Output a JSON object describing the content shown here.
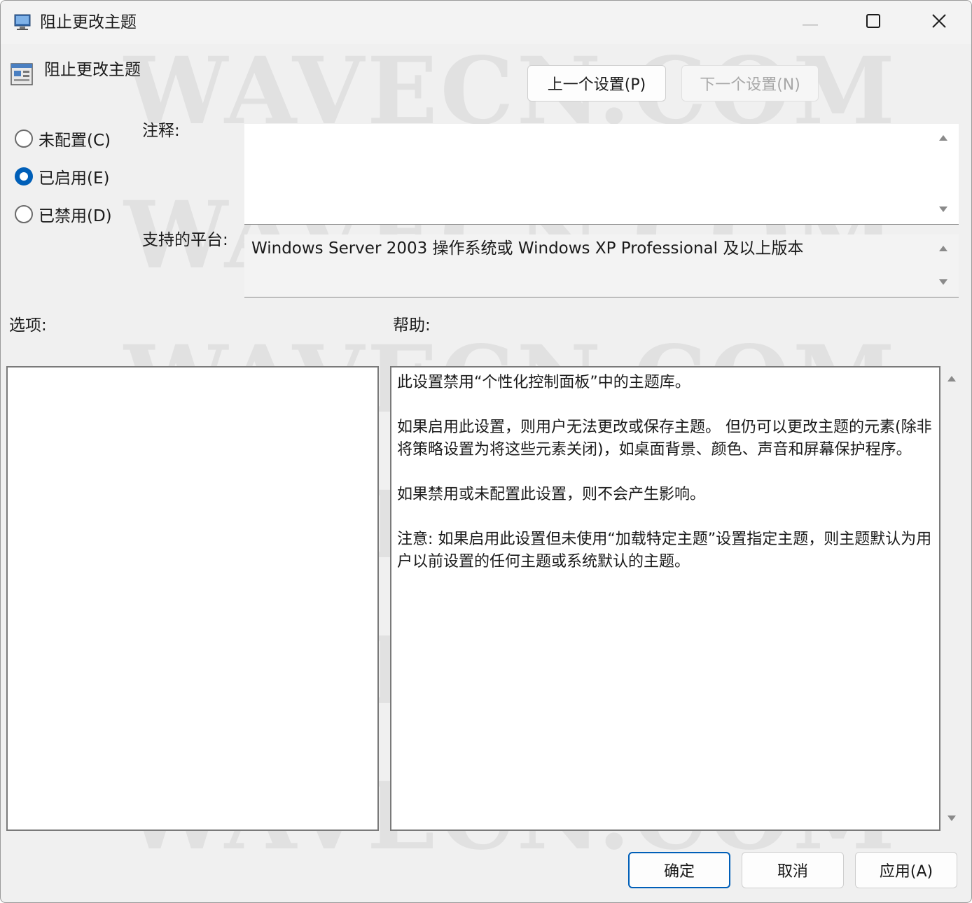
{
  "window": {
    "title": "阻止更改主题"
  },
  "header": {
    "policy_name": "阻止更改主题",
    "prev_button": "上一个设置(P)",
    "next_button": "下一个设置(N)"
  },
  "state": {
    "options": [
      {
        "label": "未配置(C)",
        "selected": false
      },
      {
        "label": "已启用(E)",
        "selected": true
      },
      {
        "label": "已禁用(D)",
        "selected": false
      }
    ]
  },
  "fields": {
    "comment_label": "注释:",
    "comment_value": "",
    "platform_label": "支持的平台:",
    "platform_value": "Windows Server 2003 操作系统或 Windows XP Professional 及以上版本"
  },
  "panels": {
    "options_label": "选项:",
    "help_label": "帮助:",
    "help_paragraphs": [
      "此设置禁用“个性化控制面板”中的主题库。",
      "如果启用此设置，则用户无法更改或保存主题。 但仍可以更改主题的元素(除非将策略设置为将这些元素关闭)，如桌面背景、颜色、声音和屏幕保护程序。",
      "如果禁用或未配置此设置，则不会产生影响。",
      "注意: 如果启用此设置但未使用“加载特定主题”设置指定主题，则主题默认为用户以前设置的任何主题或系统默认的主题。"
    ]
  },
  "footer": {
    "ok": "确定",
    "cancel": "取消",
    "apply": "应用(A)"
  },
  "watermark": "WAVECN.COM",
  "colors": {
    "accent": "#005fb8",
    "window_bg": "#f0f0f0"
  }
}
